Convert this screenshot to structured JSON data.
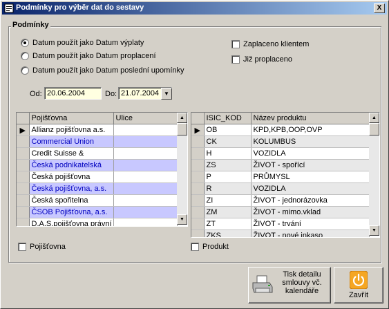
{
  "window": {
    "title": "Podmínky pro výběr dat do sestavy",
    "close_label": "X"
  },
  "group": {
    "title": "Podmínky"
  },
  "radios": [
    {
      "label": "Datum použít jako Datum výplaty",
      "checked": true
    },
    {
      "label": "Datum použít jako Datum proplacení",
      "checked": false
    },
    {
      "label": "Datum použít jako Datum poslední upomínky",
      "checked": false
    }
  ],
  "checks": {
    "zaplaceno": "Zaplaceno klientem",
    "proplaceno": "Již proplaceno",
    "pojistovna": "Pojišťovna",
    "produkt": "Produkt"
  },
  "dates": {
    "od_label": "Od:",
    "od_value": "20.06.2004",
    "do_label": "Do:",
    "do_value": "21.07.2004"
  },
  "pojistovny": {
    "columns": [
      "Pojišťovna",
      "Ulice"
    ],
    "rows": [
      "Allianz pojišťovna a.s.",
      "Commercial Union",
      "Credit Suisse &",
      "Česká podnikatelská",
      "Česká pojišťovna",
      "Česká pojišťovna, a.s.",
      "Česká spořitelna",
      "ČSOB Pojišťovna, a.s.",
      "D.A.S.pojišťovna právní"
    ]
  },
  "produkty": {
    "columns": [
      "ISIC_KOD",
      "Název produktu"
    ],
    "rows": [
      [
        "OB",
        "KPD,KPB,OOP,OVP"
      ],
      [
        "CK",
        "KOLUMBUS"
      ],
      [
        "H",
        "VOZIDLA"
      ],
      [
        "ZS",
        "ŽIVOT - spořící"
      ],
      [
        "P",
        "PRŮMYSL"
      ],
      [
        "R",
        "VOZIDLA"
      ],
      [
        "ZI",
        "ŽIVOT - jednorázovka"
      ],
      [
        "ZM",
        "ŽIVOT - mimo.vklad"
      ],
      [
        "ZT",
        "ŽIVOT - trvání"
      ],
      [
        "ZKS",
        "ŽIVOT - nové inkaso"
      ]
    ]
  },
  "buttons": {
    "print": [
      "Tisk detailu",
      "smlouvy vč.",
      "kalendáře"
    ],
    "close": "Zavřít"
  },
  "icons": {
    "print": "printer-icon",
    "close": "power-icon"
  }
}
